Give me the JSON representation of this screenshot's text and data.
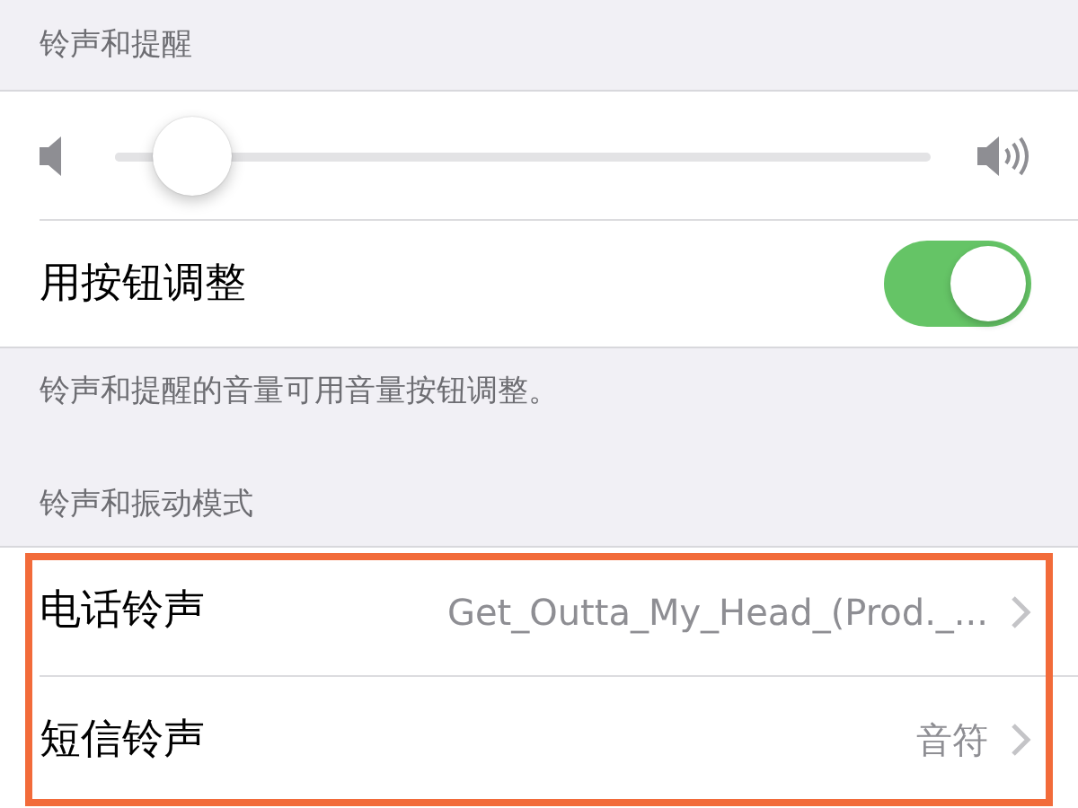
{
  "sections": [
    {
      "header": "铃声和提醒",
      "rows": [
        {
          "kind": "slider",
          "level": 0.05
        },
        {
          "kind": "toggle",
          "label": "用按钮调整",
          "on": true
        }
      ],
      "footer": "铃声和提醒的音量可用音量按钮调整。"
    },
    {
      "header": "铃声和振动模式",
      "highlighted": true,
      "rows": [
        {
          "kind": "link",
          "label": "电话铃声",
          "value": "Get_Outta_My_Head_(Prod._..."
        },
        {
          "kind": "link",
          "label": "短信铃声",
          "value": "音符"
        }
      ]
    }
  ]
}
